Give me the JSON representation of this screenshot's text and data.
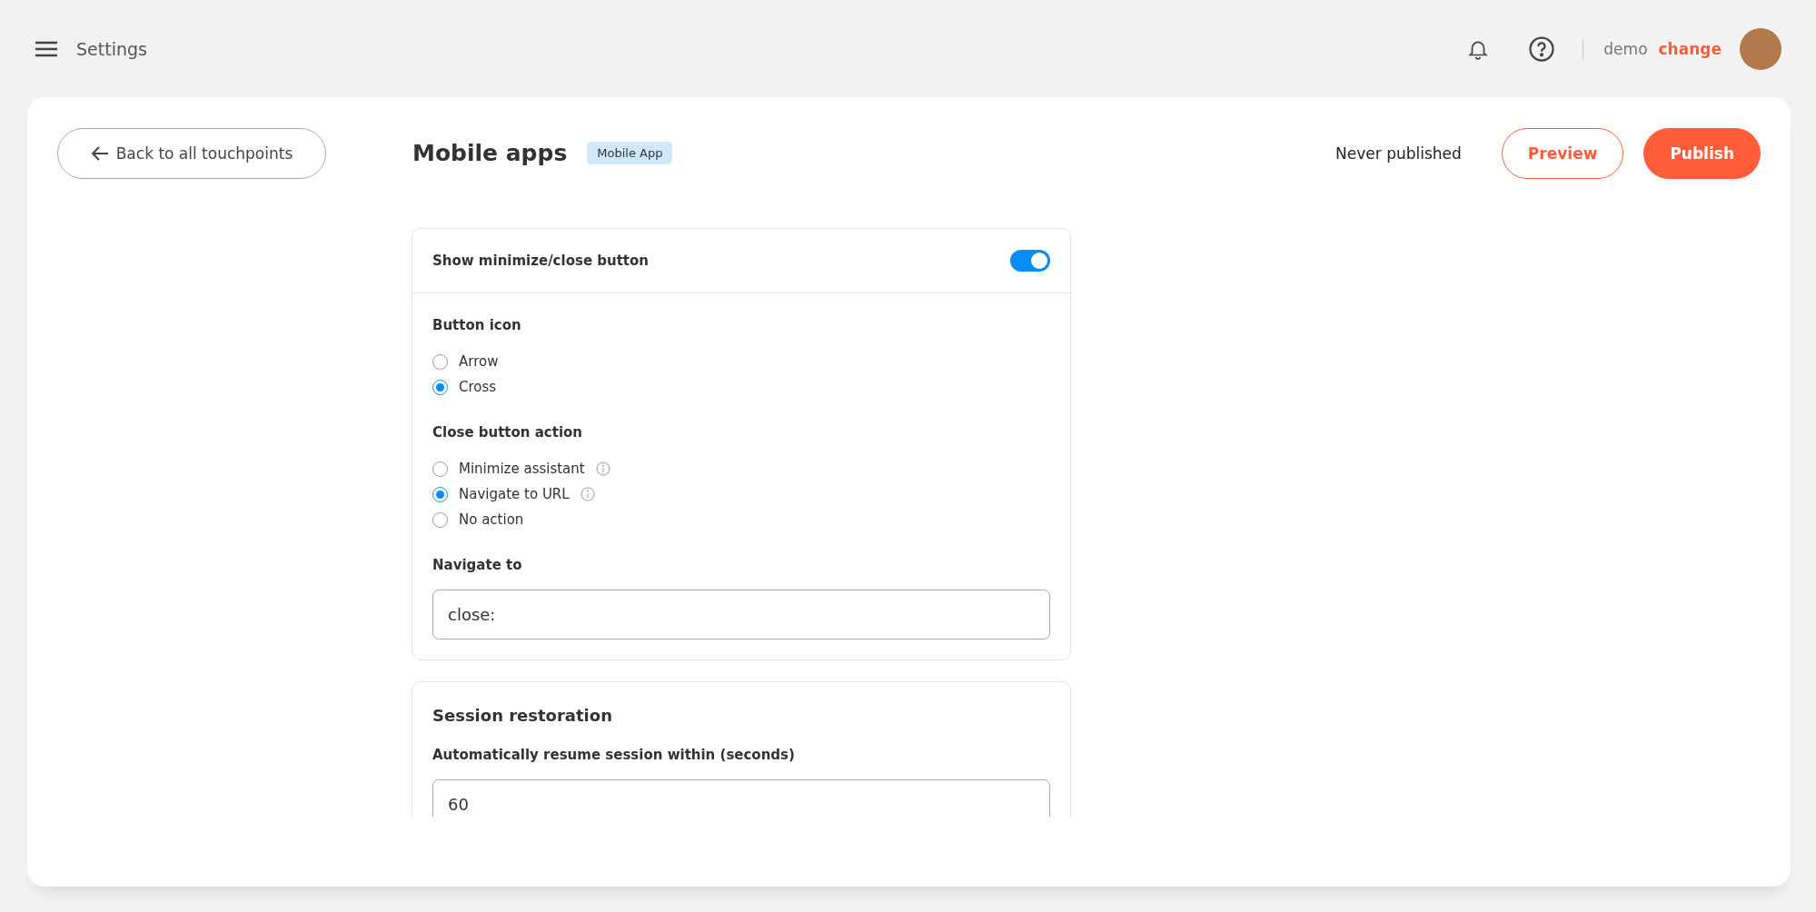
{
  "topbar": {
    "title": "Settings",
    "user": "demo",
    "change_link": "change"
  },
  "header": {
    "back_button": "Back to all touchpoints",
    "title": "Mobile apps",
    "badge": "Mobile App",
    "status": "Never published",
    "buttons": [
      {
        "label": "Preview",
        "kind": "outline"
      },
      {
        "label": "Publish",
        "kind": "primary"
      }
    ]
  },
  "close_button_panel": {
    "toggle": {
      "label": "Show minimize/close button",
      "on": true
    },
    "groups": [
      {
        "label": "Button icon",
        "options": [
          {
            "label": "Arrow",
            "selected": false,
            "has_info": false
          },
          {
            "label": "Cross",
            "selected": true,
            "has_info": false
          }
        ]
      },
      {
        "label": "Close button action",
        "options": [
          {
            "label": "Minimize assistant",
            "selected": false,
            "has_info": true
          },
          {
            "label": "Navigate to URL",
            "selected": true,
            "has_info": true
          },
          {
            "label": "No action",
            "selected": false,
            "has_info": false
          }
        ]
      }
    ],
    "navigate_field": {
      "label": "Navigate to",
      "value": "close:"
    }
  },
  "session_panel": {
    "title": "Session restoration",
    "field": {
      "label": "Automatically resume session within (seconds)",
      "value": "60"
    }
  }
}
